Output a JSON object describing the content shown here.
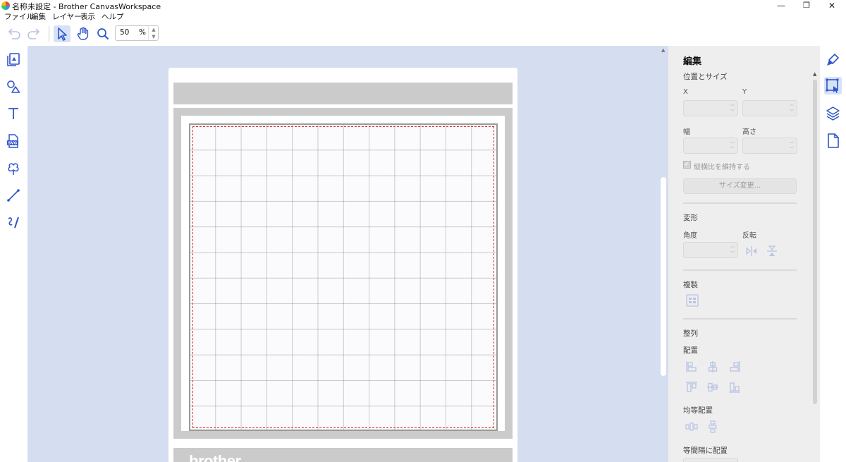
{
  "window": {
    "title": "名称未設定 - Brother CanvasWorkspace",
    "minimize": "—",
    "restore": "❐",
    "close": "✕"
  },
  "menu": {
    "items": [
      "ファイル",
      "編集",
      "レイヤー",
      "表示",
      "ヘルプ"
    ]
  },
  "toolbar": {
    "zoom_value": "50",
    "zoom_unit": "%",
    "icons": [
      "undo-icon",
      "redo-icon",
      "select-arrow-icon",
      "hand-pan-icon",
      "zoom-magnifier-icon"
    ]
  },
  "left_tools": [
    "image-import-icon",
    "shapes-icon",
    "text-icon",
    "svg-file-icon",
    "library-clover-icon",
    "line-draw-icon",
    "handwriting-icon"
  ],
  "canvas": {
    "brand": "brother",
    "background": "#d5def0",
    "cut_line_color": "#e03030"
  },
  "properties": {
    "title": "編集",
    "position_size": {
      "heading": "位置とサイズ",
      "x_label": "X",
      "y_label": "Y",
      "width_label": "幅",
      "height_label": "高さ",
      "keep_ratio_label": "縦横比を維持する",
      "resize_button": "サイズ変更..."
    },
    "transform": {
      "heading": "変形",
      "angle_label": "角度",
      "flip_label": "反転"
    },
    "duplicate": {
      "heading": "複製"
    },
    "align": {
      "heading": "整列",
      "arrange_label": "配置",
      "distribute_label": "均等配置",
      "spacing_label": "等間隔に配置"
    }
  },
  "right_tabs": [
    "paint-brush-icon",
    "edit-select-icon",
    "layers-icon",
    "page-icon"
  ],
  "colors": {
    "accent": "#3a5fd0",
    "active_bg": "#d6e2f8",
    "panel_bg": "#eeeeee"
  }
}
